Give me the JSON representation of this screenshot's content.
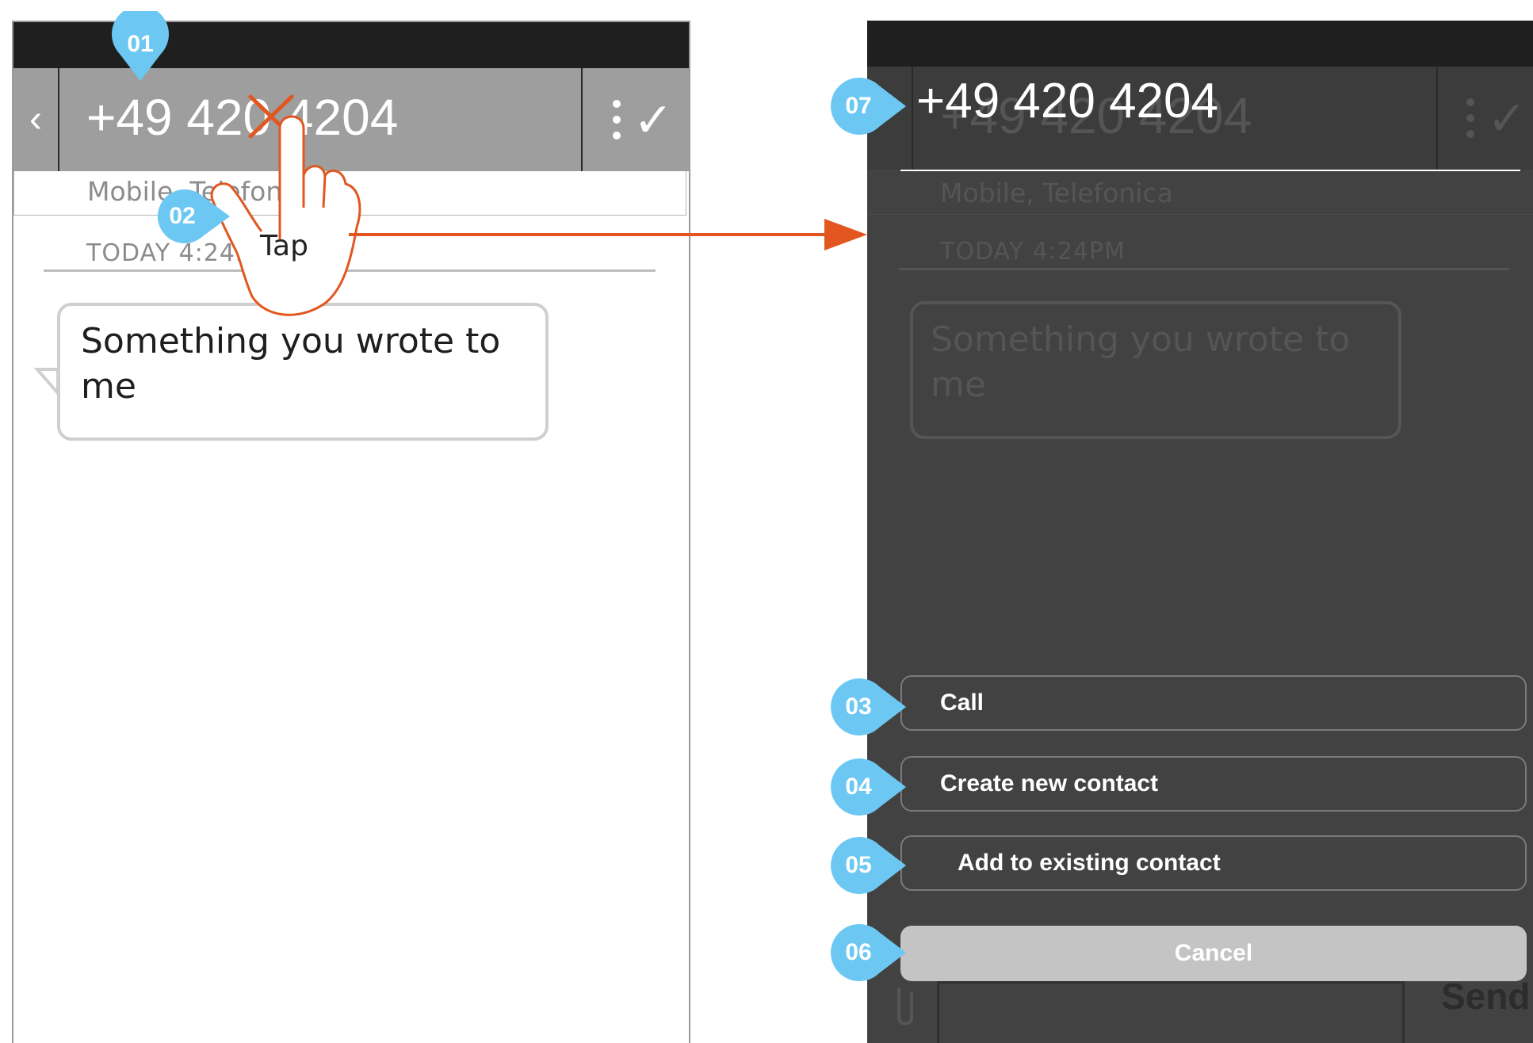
{
  "conversation": {
    "phone_number": "+49 420 4204",
    "number_details": "Mobile, Telefonica",
    "timestamp": "TODAY 4:24PM",
    "message": "Something you wrote to me"
  },
  "gesture": {
    "label": "Tap"
  },
  "action_sheet": {
    "call_label": "Call",
    "create_contact_label": "Create new contact",
    "add_existing_label": "Add to existing contact",
    "cancel_label": "Cancel"
  },
  "composer": {
    "send_label": "Send"
  },
  "annotations": [
    "01",
    "02",
    "03",
    "04",
    "05",
    "06",
    "07"
  ],
  "colors": {
    "marker_blue": "#6cc8f3",
    "gesture_orange": "#e2561f",
    "overlay_dark": "#424242",
    "header_gray": "#9e9e9e"
  },
  "icons": [
    "back-chevron-icon",
    "more-vertical-icon",
    "checkmark-icon",
    "tap-hand-icon",
    "paperclip-icon"
  ]
}
